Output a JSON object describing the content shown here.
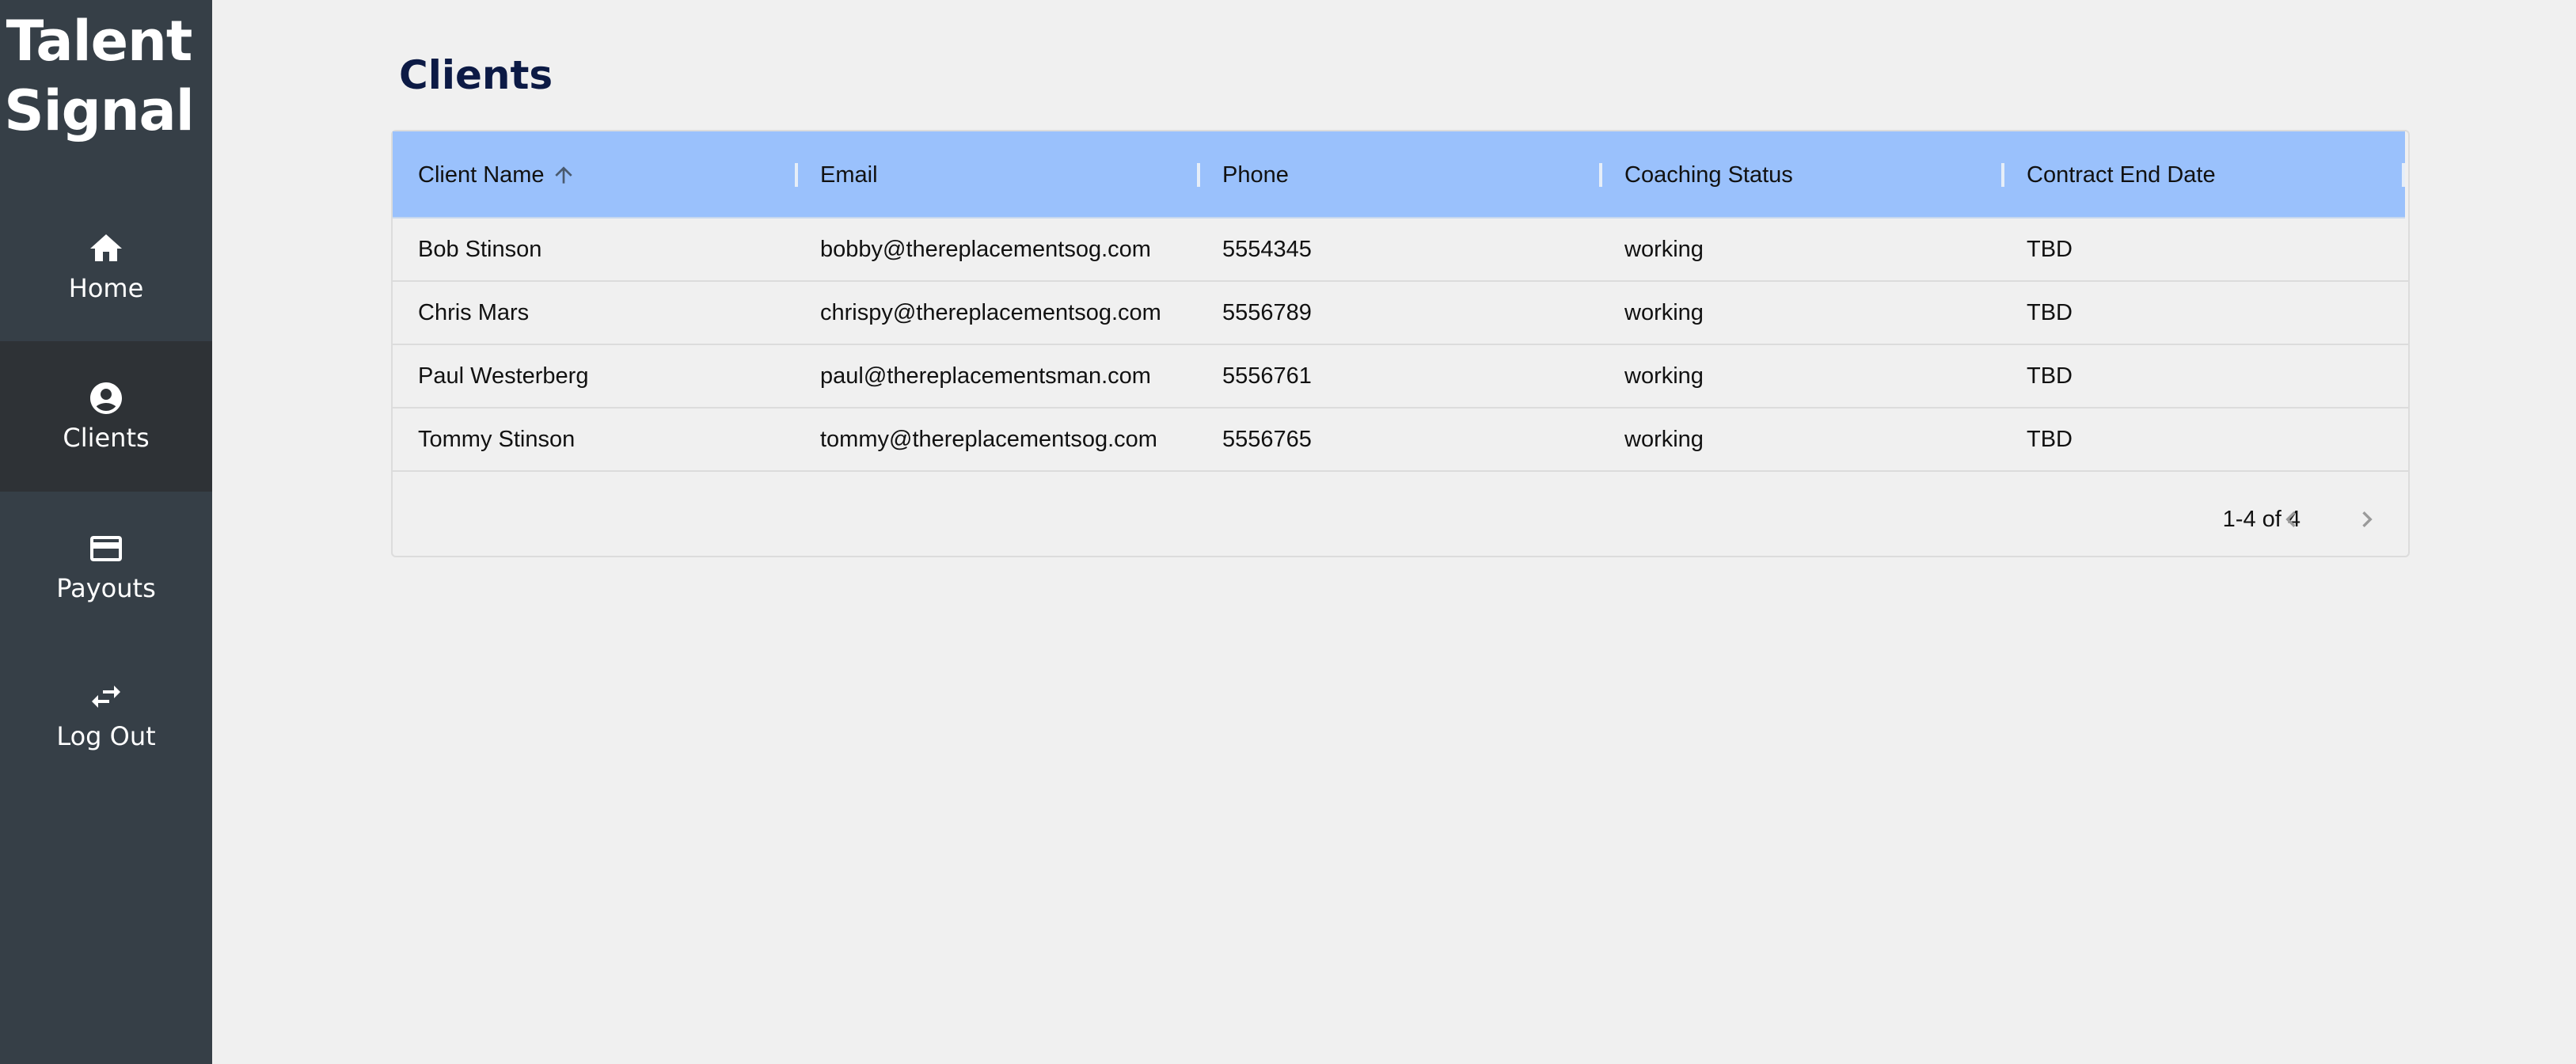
{
  "app": {
    "brand_line1": "Talent",
    "brand_line2": "Signal"
  },
  "sidebar": {
    "items": [
      {
        "label": "Home",
        "icon": "home-icon"
      },
      {
        "label": "Clients",
        "icon": "account-circle-icon",
        "active": true
      },
      {
        "label": "Payouts",
        "icon": "credit-card-icon"
      },
      {
        "label": "Log Out",
        "icon": "swap-arrows-icon"
      }
    ]
  },
  "page": {
    "title": "Clients"
  },
  "table": {
    "columns": [
      "Client Name",
      "Email",
      "Phone",
      "Coaching Status",
      "Contract End Date"
    ],
    "sort": {
      "column": "Client Name",
      "direction": "ascending"
    },
    "rows": [
      [
        "Bob Stinson",
        "bobby@thereplacementsog.com",
        "5554345",
        "working",
        "TBD"
      ],
      [
        "Chris Mars",
        "chrispy@thereplacementsog.com",
        "5556789",
        "working",
        "TBD"
      ],
      [
        "Paul Westerberg",
        "paul@thereplacementsman.com",
        "5556761",
        "working",
        "TBD"
      ],
      [
        "Tommy Stinson",
        "tommy@thereplacementsog.com",
        "5556765",
        "working",
        "TBD"
      ]
    ],
    "pagination": {
      "range_label": "1-4 of 4"
    }
  },
  "colors": {
    "sidebar_bg": "#363f47",
    "sidebar_active_bg": "#2e3236",
    "header_bg": "#9ac1fc",
    "title_color": "#0c1a45",
    "page_bg": "#f0f0f0"
  }
}
